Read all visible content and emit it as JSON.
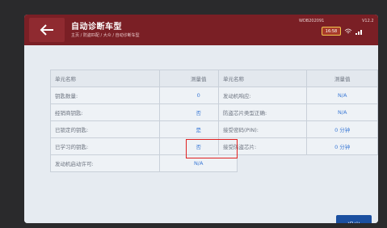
{
  "header": {
    "title": "自动诊断车型",
    "breadcrumb": "主页 / 防盗匹配 / 大众 / 自动诊断车型",
    "vin": "WDB202091",
    "version": "V12.2",
    "battery": "16:58"
  },
  "left_table": {
    "col_name": "单元名称",
    "col_value": "测量值",
    "rows": [
      {
        "name": "钥匙数量:",
        "value": "0"
      },
      {
        "name": "经销商钥匙:",
        "value": "否"
      },
      {
        "name": "已锁定的钥匙:",
        "value": "是"
      },
      {
        "name": "已学习的钥匙:",
        "value": "否"
      },
      {
        "name": "发动机启动许可:",
        "value": "N/A"
      }
    ]
  },
  "right_table": {
    "col_name": "单元名称",
    "col_value": "测量值",
    "rows": [
      {
        "name": "发动机响应:",
        "value": "N/A"
      },
      {
        "name": "防盗芯片类型正确:",
        "value": "N/A"
      },
      {
        "name": "接受密码(PIN):",
        "value": "0 分钟"
      },
      {
        "name": "接受防盗芯片:",
        "value": "0 分钟"
      }
    ]
  },
  "buttons": {
    "exit": "退出"
  }
}
